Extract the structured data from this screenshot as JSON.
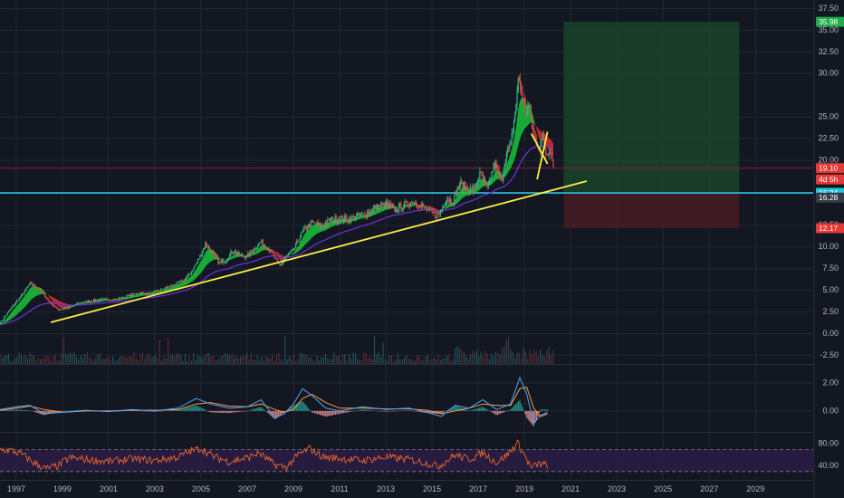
{
  "colors": {
    "background": "#131722",
    "grid": "#232733",
    "divider": "#2a2e39",
    "axis_text": "#b2b5be",
    "candle_up": "#2fb97f",
    "candle_down": "#e04a4a",
    "cloud_up": "#18c43a",
    "cloud_down": "#d83030",
    "ma_line": "#6a2fd0",
    "trendline": "#ffee44",
    "support_line": "#2ec5e8",
    "resistance_line": "#8a1f2e",
    "target_zone": "#1c4a2c",
    "stop_zone": "#4a1d24",
    "macd_line": "#4fa3ff",
    "signal_line": "#ff9b38",
    "rsi_line": "#e8642a",
    "rsi_band": "#2a1d44"
  },
  "price_axis": {
    "ticks": [
      "37.50",
      "35.00",
      "32.50",
      "30.00",
      "25.00",
      "22.50",
      "20.00",
      "12.50",
      "10.00",
      "7.50",
      "5.00",
      "2.50",
      "0.00",
      "-2.50"
    ]
  },
  "price_tags": [
    {
      "label": "35.98",
      "value": 35.98,
      "color": "#22ab4a"
    },
    {
      "label": "19.10",
      "value": 19.1,
      "color": "#e53935"
    },
    {
      "label": "4d 5h",
      "value": 17.8,
      "color": "#e53935"
    },
    {
      "label": "16.24",
      "value": 16.24,
      "color": "#26c6da"
    },
    {
      "label": "16.28",
      "value": 15.7,
      "color": "#363a45"
    },
    {
      "label": "12.17",
      "value": 12.17,
      "color": "#e53935"
    }
  ],
  "macd_axis": {
    "ticks": [
      "2.00",
      "0.00"
    ]
  },
  "rsi_axis": {
    "ticks": [
      "80.00",
      "40.00"
    ],
    "band_upper": 70,
    "band_lower": 30
  },
  "time_axis": {
    "ticks": [
      "1997",
      "1999",
      "2001",
      "2003",
      "2005",
      "2007",
      "2009",
      "2011",
      "2013",
      "2015",
      "2017",
      "2019",
      "2021",
      "2023",
      "2025",
      "2027",
      "2029"
    ]
  },
  "chart_data": {
    "type": "line",
    "title": "",
    "y_scale": "linear",
    "xlim": [
      1996.3,
      2031.5
    ],
    "ylim": [
      -3.5,
      38.5
    ],
    "grid": true,
    "price_path": {
      "x": [
        1996.3,
        1996.8,
        1997.3,
        1997.6,
        1998.0,
        1998.4,
        1998.8,
        1999.3,
        1999.8,
        2000.3,
        2000.8,
        2001.3,
        2001.8,
        2002.3,
        2002.8,
        2003.3,
        2003.8,
        2004.3,
        2004.6,
        2004.9,
        2005.2,
        2005.5,
        2005.8,
        2006.1,
        2006.4,
        2006.7,
        2007.0,
        2007.3,
        2007.6,
        2008.0,
        2008.4,
        2008.7,
        2009.0,
        2009.4,
        2009.8,
        2010.2,
        2010.6,
        2011.0,
        2011.4,
        2011.8,
        2012.2,
        2012.6,
        2013.0,
        2013.4,
        2013.8,
        2014.2,
        2014.6,
        2015.0,
        2015.3,
        2015.6,
        2015.9,
        2016.2,
        2016.5,
        2016.8,
        2017.1,
        2017.4,
        2017.7,
        2018.0,
        2018.2,
        2018.4,
        2018.6,
        2018.75,
        2018.9,
        2019.05,
        2019.2,
        2019.35,
        2019.5,
        2019.65,
        2019.8,
        2019.95,
        2020.1,
        2020.25
      ],
      "y": [
        1.2,
        3.0,
        4.6,
        5.8,
        5.2,
        3.8,
        2.8,
        3.0,
        3.6,
        3.8,
        4.0,
        3.9,
        4.3,
        4.7,
        4.6,
        5.1,
        5.6,
        6.2,
        7.2,
        8.6,
        10.4,
        9.3,
        8.1,
        8.6,
        9.6,
        9.0,
        8.9,
        9.8,
        10.6,
        9.6,
        7.8,
        8.9,
        9.6,
        11.8,
        12.8,
        12.4,
        13.1,
        13.3,
        13.2,
        13.6,
        13.9,
        14.6,
        14.9,
        14.3,
        14.8,
        15.3,
        14.6,
        13.9,
        13.6,
        15.6,
        15.3,
        17.3,
        16.8,
        16.6,
        18.4,
        16.6,
        19.6,
        17.6,
        20.6,
        21.6,
        25.6,
        29.6,
        27.6,
        25.6,
        26.4,
        23.6,
        22.1,
        21.6,
        22.6,
        20.6,
        21.6,
        19.6
      ]
    },
    "trendline": {
      "from": [
        1998.5,
        1.3
      ],
      "to": [
        2021.7,
        17.6
      ]
    },
    "wedge_lines": [
      {
        "from": [
          2019.55,
          17.8
        ],
        "to": [
          2020.0,
          23.3
        ]
      },
      {
        "from": [
          2019.3,
          23.1
        ],
        "to": [
          2020.0,
          19.6
        ]
      }
    ],
    "horizontal_levels": [
      16.24,
      19.1
    ],
    "long_position": {
      "x_from": 2020.7,
      "x_to": 2028.3,
      "entry": 16.24,
      "target": 35.98,
      "stop": 12.17
    },
    "macd": {
      "ylim": [
        -1.5,
        3.3
      ],
      "x": [
        1996.3,
        1997.0,
        1997.6,
        1998.2,
        1999.0,
        2000.0,
        2001.0,
        2002.0,
        2003.0,
        2004.0,
        2004.8,
        2005.4,
        2006.2,
        2007.0,
        2007.6,
        2008.2,
        2008.6,
        2009.0,
        2009.4,
        2009.8,
        2010.4,
        2011.0,
        2012.0,
        2013.0,
        2014.0,
        2014.8,
        2015.4,
        2016.0,
        2016.6,
        2017.2,
        2017.8,
        2018.4,
        2018.8,
        2019.1,
        2019.4,
        2019.7,
        2020.0
      ],
      "macd": [
        0.1,
        0.3,
        0.4,
        -0.2,
        -0.1,
        0.05,
        -0.05,
        0.1,
        0.0,
        0.2,
        0.9,
        0.5,
        0.2,
        0.3,
        0.8,
        -0.5,
        -0.2,
        0.5,
        1.6,
        1.1,
        0.2,
        0.0,
        0.3,
        0.1,
        0.2,
        -0.1,
        -0.4,
        0.4,
        0.2,
        0.8,
        0.1,
        0.5,
        2.4,
        1.2,
        -0.9,
        -0.3,
        -0.1
      ],
      "signal": [
        0.05,
        0.2,
        0.35,
        0.1,
        -0.1,
        0.0,
        0.0,
        0.05,
        0.05,
        0.1,
        0.5,
        0.6,
        0.35,
        0.3,
        0.5,
        0.1,
        -0.1,
        0.1,
        0.9,
        1.2,
        0.6,
        0.2,
        0.2,
        0.15,
        0.15,
        0.05,
        -0.2,
        0.0,
        0.2,
        0.5,
        0.4,
        0.4,
        1.6,
        1.7,
        0.2,
        -0.4,
        -0.2
      ]
    },
    "rsi": {
      "ylim": [
        15,
        100
      ],
      "x": [
        1996.3,
        1996.8,
        1997.3,
        1997.8,
        1998.3,
        1998.8,
        1999.3,
        2000.0,
        2001.0,
        2002.0,
        2003.0,
        2004.0,
        2004.5,
        2005.0,
        2005.5,
        2006.2,
        2007.0,
        2007.5,
        2008.2,
        2008.7,
        2009.2,
        2009.7,
        2010.3,
        2011.0,
        2012.0,
        2013.0,
        2014.0,
        2014.7,
        2015.3,
        2016.0,
        2016.6,
        2017.2,
        2017.8,
        2018.3,
        2018.7,
        2019.0,
        2019.3,
        2019.6,
        2020.0
      ],
      "values": [
        70,
        68,
        60,
        45,
        35,
        40,
        55,
        52,
        48,
        53,
        50,
        56,
        66,
        72,
        58,
        48,
        55,
        64,
        42,
        38,
        60,
        72,
        56,
        54,
        50,
        56,
        52,
        46,
        40,
        60,
        52,
        64,
        46,
        62,
        82,
        60,
        36,
        44,
        42
      ]
    }
  }
}
